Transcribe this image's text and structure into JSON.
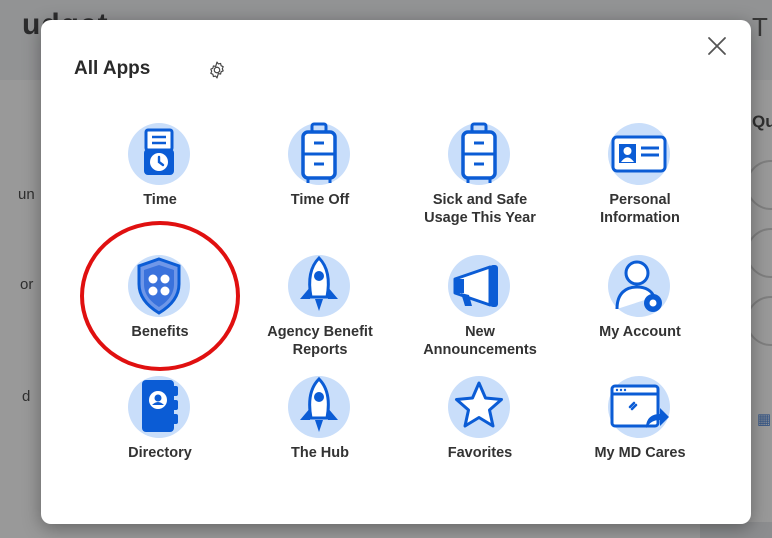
{
  "background": {
    "page_title": "udget",
    "title_right_fragment": "T",
    "right_heading_fragment": "Qu",
    "side_fragments": [
      "un",
      "or",
      "d"
    ]
  },
  "modal": {
    "title": "All Apps",
    "settings_icon": "gear-icon",
    "close_icon": "close-icon",
    "apps": [
      {
        "label": "Time",
        "icon": "time-clock-icon"
      },
      {
        "label": "Time Off",
        "icon": "luggage-icon"
      },
      {
        "label": "Sick and Safe\nUsage This Year",
        "icon": "luggage-icon"
      },
      {
        "label": "Personal\nInformation",
        "icon": "id-card-icon"
      },
      {
        "label": "Benefits",
        "icon": "benefits-shield-icon"
      },
      {
        "label": "Agency Benefit\nReports",
        "icon": "rocket-icon"
      },
      {
        "label": "New\nAnnouncements",
        "icon": "megaphone-icon"
      },
      {
        "label": "My Account",
        "icon": "user-gear-icon"
      },
      {
        "label": "Directory",
        "icon": "directory-book-icon"
      },
      {
        "label": "The Hub",
        "icon": "rocket-icon"
      },
      {
        "label": "Favorites",
        "icon": "star-icon"
      },
      {
        "label": "My MD Cares",
        "icon": "web-share-icon"
      }
    ]
  },
  "colors": {
    "icon_bg": "#c9defa",
    "icon_primary": "#0b5cd5",
    "highlight": "#e01010"
  }
}
